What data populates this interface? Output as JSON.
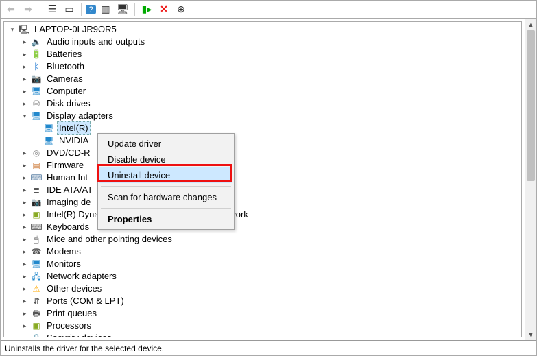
{
  "toolbar": {
    "back_tip": "Back",
    "fwd_tip": "Forward",
    "view_tip": "Show hidden",
    "help_tip": "Help",
    "redx_tip": "Uninstall"
  },
  "tree": {
    "root": {
      "label": "LAPTOP-0LJR9OR5"
    },
    "nodes": [
      {
        "label": "Audio inputs and outputs",
        "icon": "speaker-icon",
        "exp": ">"
      },
      {
        "label": "Batteries",
        "icon": "battery-icon",
        "exp": ">"
      },
      {
        "label": "Bluetooth",
        "icon": "bluetooth-icon",
        "exp": ">"
      },
      {
        "label": "Cameras",
        "icon": "camera-icon",
        "exp": ">"
      },
      {
        "label": "Computer",
        "icon": "computer-icon",
        "exp": ">"
      },
      {
        "label": "Disk drives",
        "icon": "disk-icon",
        "exp": ">"
      },
      {
        "label": "Display adapters",
        "icon": "display-icon",
        "exp": "v",
        "children": [
          {
            "label": "Intel(R)",
            "icon": "gpu-icon",
            "selected": true
          },
          {
            "label": "NVIDIA",
            "icon": "gpu-icon"
          }
        ]
      },
      {
        "label": "DVD/CD-R",
        "icon": "dvd-icon",
        "exp": ">",
        "truncated": true
      },
      {
        "label": "Firmware",
        "icon": "firmware-icon",
        "exp": ">",
        "truncated": true
      },
      {
        "label": "Human Int",
        "icon": "hid-icon",
        "exp": ">",
        "truncated": true
      },
      {
        "label": "IDE ATA/AT",
        "icon": "ide-icon",
        "exp": ">",
        "truncated": true
      },
      {
        "label": "Imaging de",
        "icon": "imaging-icon",
        "exp": ">",
        "truncated": true
      },
      {
        "label": "Intel(R) Dynamic Platform and Thermal Framework",
        "icon": "cpu-icon",
        "exp": ">"
      },
      {
        "label": "Keyboards",
        "icon": "keyboard-icon",
        "exp": ">"
      },
      {
        "label": "Mice and other pointing devices",
        "icon": "mouse-icon",
        "exp": ">"
      },
      {
        "label": "Modems",
        "icon": "modem-icon",
        "exp": ">"
      },
      {
        "label": "Monitors",
        "icon": "monitor-icon",
        "exp": ">"
      },
      {
        "label": "Network adapters",
        "icon": "net-icon",
        "exp": ">"
      },
      {
        "label": "Other devices",
        "icon": "other-icon",
        "exp": ">"
      },
      {
        "label": "Ports (COM & LPT)",
        "icon": "port-icon",
        "exp": ">"
      },
      {
        "label": "Print queues",
        "icon": "printer-icon",
        "exp": ">"
      },
      {
        "label": "Processors",
        "icon": "cpu-icon",
        "exp": ">"
      },
      {
        "label": "Security devices",
        "icon": "security-icon",
        "exp": ">"
      }
    ]
  },
  "context_menu": {
    "items": [
      {
        "label": "Update driver"
      },
      {
        "label": "Disable device"
      },
      {
        "label": "Uninstall device",
        "hover": true,
        "highlighted": true
      },
      {
        "sep": true
      },
      {
        "label": "Scan for hardware changes"
      },
      {
        "sep": true
      },
      {
        "label": "Properties",
        "bold": true
      }
    ]
  },
  "status": {
    "text": "Uninstalls the driver for the selected device."
  },
  "icon_glyphs": {
    "speaker-icon": "🔈",
    "battery-icon": "🔋",
    "bluetooth-icon": "ᛒ",
    "camera-icon": "📷",
    "computer-icon": "🖥",
    "disk-icon": "⛁",
    "display-icon": "🖥",
    "gpu-icon": "🖥",
    "dvd-icon": "◎",
    "firmware-icon": "▤",
    "hid-icon": "⌨",
    "ide-icon": "≣",
    "imaging-icon": "📷",
    "cpu-icon": "▣",
    "keyboard-icon": "⌨",
    "mouse-icon": "🖱",
    "modem-icon": "☎",
    "monitor-icon": "🖥",
    "net-icon": "🖧",
    "other-icon": "⚠",
    "port-icon": "⇵",
    "printer-icon": "🖶",
    "security-icon": "🔒",
    "pc-icon": "🖳"
  }
}
